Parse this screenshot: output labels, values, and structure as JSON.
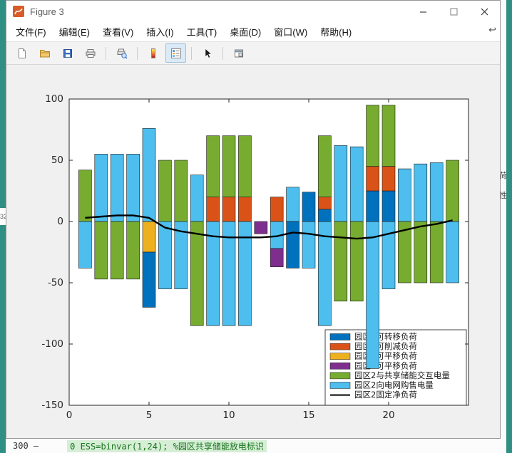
{
  "window": {
    "title": "Figure 3"
  },
  "menu": {
    "items": [
      {
        "label": "文件(F)"
      },
      {
        "label": "编辑(E)"
      },
      {
        "label": "查看(V)"
      },
      {
        "label": "插入(I)"
      },
      {
        "label": "工具(T)"
      },
      {
        "label": "桌面(D)"
      },
      {
        "label": "窗口(W)"
      },
      {
        "label": "帮助(H)"
      }
    ],
    "overflow_icon": "↩"
  },
  "toolbar": {
    "buttons": [
      {
        "name": "new-figure"
      },
      {
        "name": "open-file"
      },
      {
        "name": "save-figure"
      },
      {
        "name": "print-figure"
      },
      {
        "name": "print-preview"
      },
      {
        "name": "insert-colorbar"
      },
      {
        "name": "insert-legend",
        "active": true
      },
      {
        "name": "edit-plot"
      },
      {
        "name": "dock-figure"
      }
    ]
  },
  "background": {
    "left_fragment": "32",
    "right_fragments": [
      "荷",
      "性"
    ],
    "bottom": {
      "line_number": "300 —",
      "code": "0 ESS=binvar(1,24); %园区共享储能放电标识"
    }
  },
  "chart_data": {
    "type": "bar",
    "stacked": true,
    "title": "",
    "xlabel": "",
    "ylabel": "",
    "xlim": [
      0,
      25
    ],
    "ylim": [
      -150,
      100
    ],
    "xticks": [
      0,
      5,
      10,
      15,
      20
    ],
    "yticks": [
      -150,
      -100,
      -50,
      0,
      50,
      100
    ],
    "hours": [
      1,
      2,
      3,
      4,
      5,
      6,
      7,
      8,
      9,
      10,
      11,
      12,
      13,
      14,
      15,
      16,
      17,
      18,
      19,
      20,
      21,
      22,
      23,
      24
    ],
    "colors": {
      "transferable": "#0072BD",
      "curtailable": "#D95319",
      "shiftable_yellow": "#EDB120",
      "shiftable_purple": "#7E2F8E",
      "storage": "#77AC30",
      "grid_trade": "#4DBEEE",
      "fixed_net_load": "#000000"
    },
    "legend": [
      {
        "key": "transferable",
        "label": "园区2可转移负荷",
        "swatch": "patch"
      },
      {
        "key": "curtailable",
        "label": "园区2可削减负荷",
        "swatch": "patch"
      },
      {
        "key": "shiftable_yellow",
        "label": "园区2可平移负荷",
        "swatch": "patch"
      },
      {
        "key": "shiftable_purple",
        "label": "园区2可平移负荷",
        "swatch": "patch"
      },
      {
        "key": "storage",
        "label": "园区2与共享储能交互电量",
        "swatch": "patch"
      },
      {
        "key": "grid_trade",
        "label": "园区2向电网购售电量",
        "swatch": "patch"
      },
      {
        "key": "fixed_net_load",
        "label": "园区2固定净负荷",
        "swatch": "line"
      }
    ],
    "bars": [
      [
        [
          "storage",
          42
        ],
        [
          "grid_trade",
          -38
        ]
      ],
      [
        [
          "grid_trade",
          55
        ],
        [
          "storage",
          -47
        ]
      ],
      [
        [
          "grid_trade",
          55
        ],
        [
          "storage",
          -47
        ]
      ],
      [
        [
          "grid_trade",
          55
        ],
        [
          "storage",
          -47
        ]
      ],
      [
        [
          "grid_trade",
          76
        ],
        [
          "shiftable_yellow",
          -25
        ],
        [
          "transferable",
          -45
        ]
      ],
      [
        [
          "storage",
          50
        ],
        [
          "grid_trade",
          -55
        ]
      ],
      [
        [
          "storage",
          50
        ],
        [
          "grid_trade",
          -55
        ]
      ],
      [
        [
          "grid_trade",
          38
        ],
        [
          "storage",
          -85
        ]
      ],
      [
        [
          "curtailable",
          20
        ],
        [
          "storage",
          50
        ],
        [
          "grid_trade",
          -85
        ]
      ],
      [
        [
          "curtailable",
          20
        ],
        [
          "storage",
          50
        ],
        [
          "grid_trade",
          -85
        ]
      ],
      [
        [
          "curtailable",
          20
        ],
        [
          "storage",
          50
        ],
        [
          "grid_trade",
          -85
        ]
      ],
      [
        [
          "shiftable_purple",
          -10
        ]
      ],
      [
        [
          "curtailable",
          20
        ],
        [
          "grid_trade",
          -22
        ],
        [
          "shiftable_purple",
          -15
        ]
      ],
      [
        [
          "grid_trade",
          28
        ],
        [
          "transferable",
          -38
        ]
      ],
      [
        [
          "transferable",
          24
        ],
        [
          "grid_trade",
          -38
        ]
      ],
      [
        [
          "transferable",
          10
        ],
        [
          "curtailable",
          10
        ],
        [
          "storage",
          50
        ],
        [
          "grid_trade",
          -85
        ]
      ],
      [
        [
          "grid_trade",
          62
        ],
        [
          "storage",
          -65
        ]
      ],
      [
        [
          "grid_trade",
          61
        ],
        [
          "storage",
          -65
        ]
      ],
      [
        [
          "transferable",
          25
        ],
        [
          "curtailable",
          20
        ],
        [
          "storage",
          50
        ],
        [
          "grid_trade",
          -120
        ]
      ],
      [
        [
          "transferable",
          25
        ],
        [
          "curtailable",
          20
        ],
        [
          "storage",
          50
        ],
        [
          "grid_trade",
          -55
        ]
      ],
      [
        [
          "grid_trade",
          43
        ],
        [
          "storage",
          -50
        ]
      ],
      [
        [
          "grid_trade",
          47
        ],
        [
          "storage",
          -50
        ]
      ],
      [
        [
          "grid_trade",
          48
        ],
        [
          "storage",
          -50
        ]
      ],
      [
        [
          "storage",
          50
        ],
        [
          "grid_trade",
          -50
        ]
      ]
    ],
    "line": {
      "key": "fixed_net_load",
      "values": [
        3,
        4,
        5,
        5,
        3,
        -5,
        -8,
        -10,
        -12,
        -13,
        -13,
        -13,
        -12,
        -9,
        -10,
        -12,
        -13,
        -14,
        -13,
        -10,
        -7,
        -4,
        -2,
        1
      ]
    }
  }
}
